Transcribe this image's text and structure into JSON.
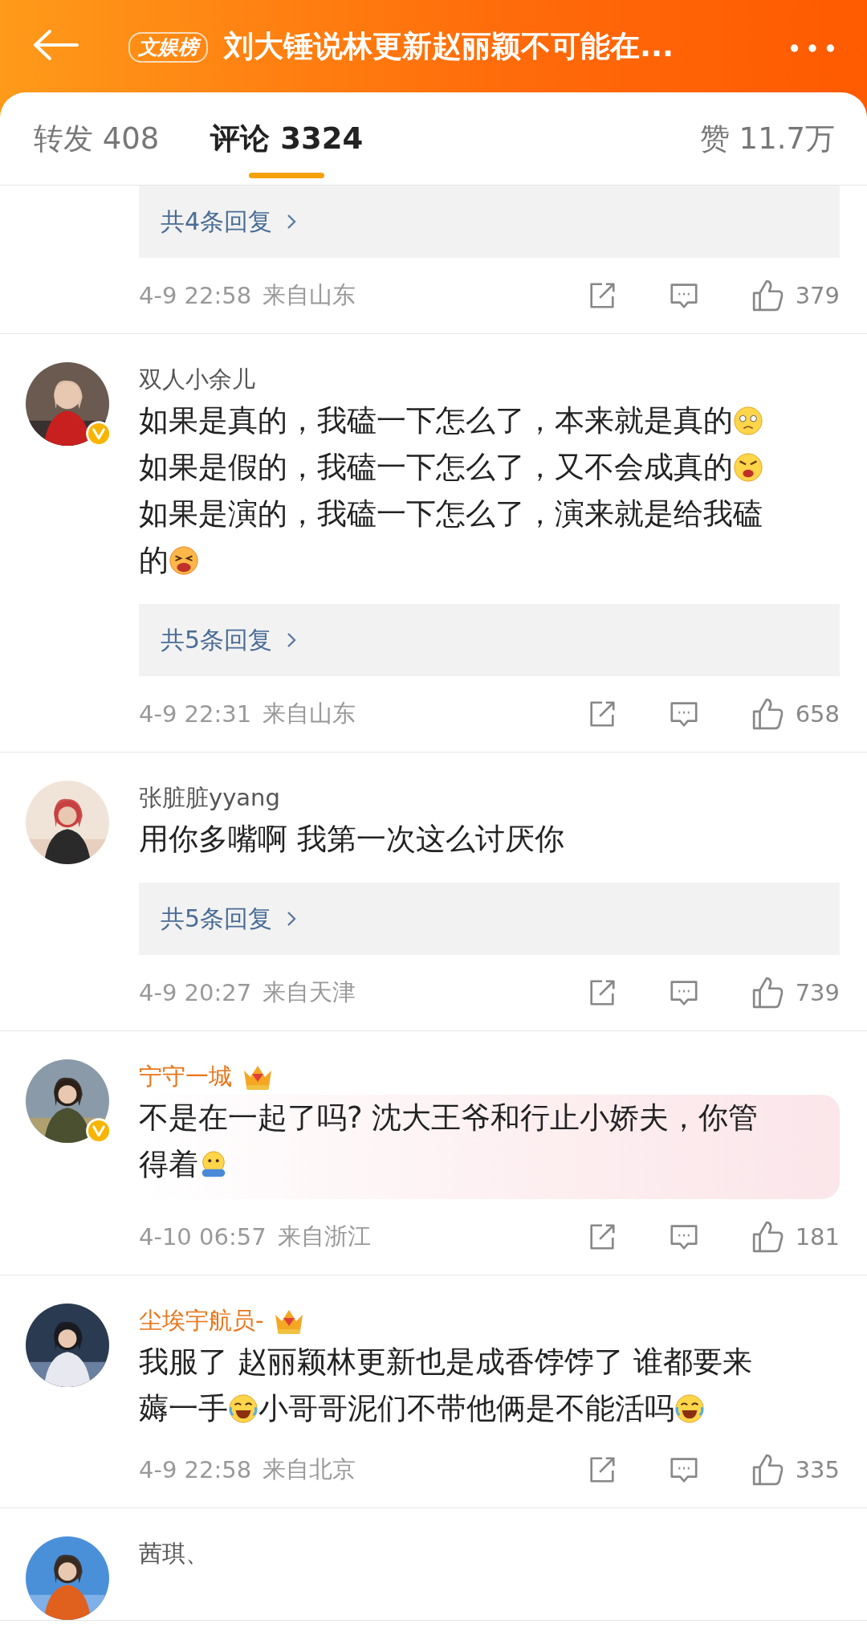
{
  "header": {
    "badge": "文娱榜",
    "title": "刘大锤说林更新赵丽颖不可能在..."
  },
  "tabs": [
    {
      "label": "转发 408",
      "selected": false
    },
    {
      "label": "评论 3324",
      "selected": true
    }
  ],
  "likes_tab": {
    "label": "赞 11.7万"
  },
  "comments": [
    {
      "replies": "共4条回复",
      "time": "4-9 22:58",
      "location": "来自山东",
      "likes": "379"
    },
    {
      "user": {
        "name": "双人小余儿",
        "verified": true,
        "vip": false
      },
      "highlighted": false,
      "lines": [
        [
          {
            "kind": "text",
            "text": "如果是真的，我磕一下怎么了，本来就是真的"
          },
          {
            "kind": "tearful"
          }
        ],
        [
          {
            "kind": "text",
            "text": "如果是假的，我磕一下怎么了，又不会成真的"
          },
          {
            "kind": "angry"
          }
        ],
        [
          {
            "kind": "text",
            "text": "如果是演的，我磕一下怎么了，演来就是给我磕"
          }
        ],
        [
          {
            "kind": "text",
            "text": "的"
          },
          {
            "kind": "crying"
          }
        ]
      ],
      "replies": "共5条回复",
      "time": "4-9 22:31",
      "location": "来自山东",
      "likes": "658"
    },
    {
      "user": {
        "name": "张脏脏yyang",
        "verified": false,
        "vip": false
      },
      "highlighted": false,
      "lines": [
        [
          {
            "kind": "text",
            "text": "用你多嘴啊 我第一次这么讨厌你"
          }
        ]
      ],
      "replies": "共5条回复",
      "time": "4-9 20:27",
      "location": "来自天津",
      "likes": "739"
    },
    {
      "user": {
        "name": "宁守一城",
        "verified": true,
        "vip": true
      },
      "highlighted": true,
      "lines": [
        [
          {
            "kind": "text",
            "text": "不是在一起了吗? 沈大王爷和行止小娇夫，你管"
          }
        ],
        [
          {
            "kind": "text",
            "text": "得着"
          },
          {
            "kind": "hug"
          }
        ]
      ],
      "time": "4-10 06:57",
      "location": "来自浙江",
      "likes": "181"
    },
    {
      "user": {
        "name": "尘埃宇航员-",
        "verified": false,
        "vip": true
      },
      "highlighted": false,
      "lines": [
        [
          {
            "kind": "text",
            "text": "我服了 赵丽颖林更新也是成香饽饽了 谁都要来"
          }
        ],
        [
          {
            "kind": "text",
            "text": "薅一手"
          },
          {
            "kind": "lol"
          },
          {
            "kind": "text",
            "text": "小哥哥泥们不带他俩是不能活吗"
          },
          {
            "kind": "lol"
          }
        ]
      ],
      "time": "4-9 22:58",
      "location": "来自北京",
      "likes": "335"
    },
    {
      "user": {
        "name": "茜琪、",
        "verified": false,
        "vip": false
      }
    }
  ]
}
